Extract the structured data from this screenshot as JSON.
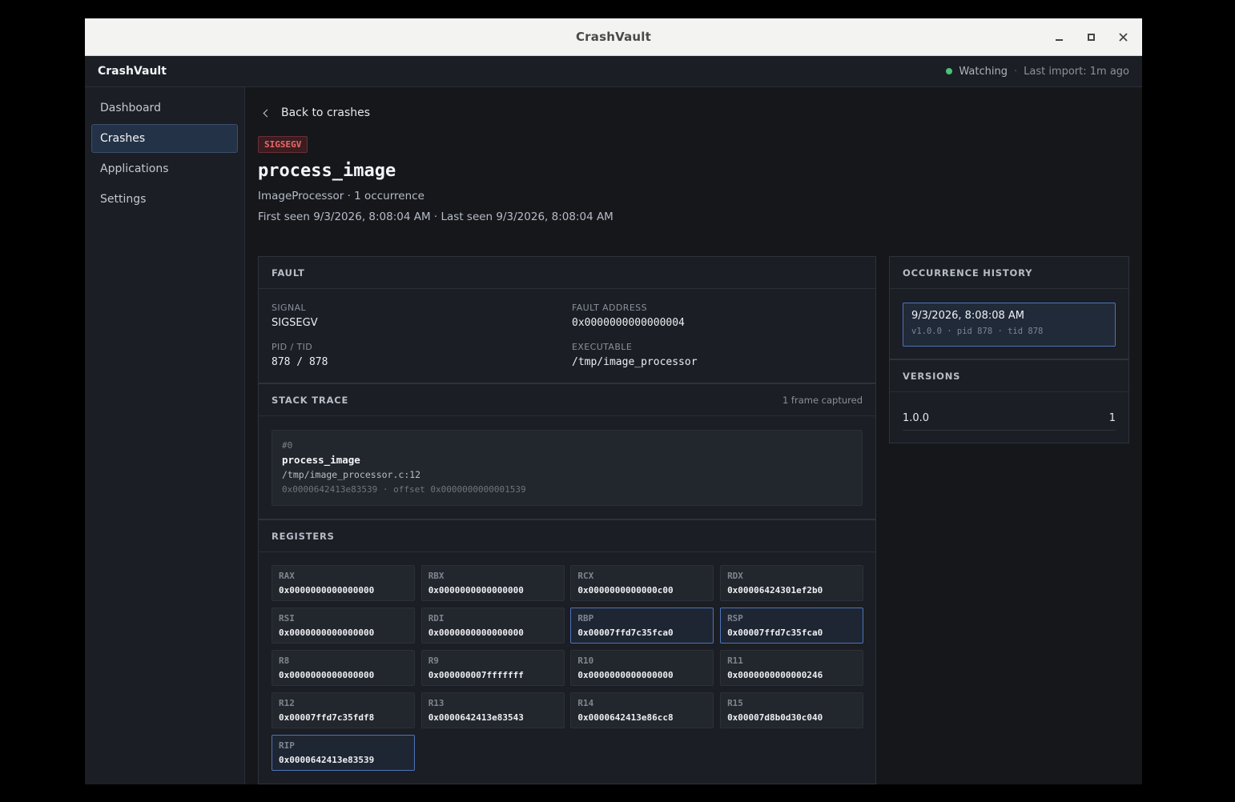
{
  "window": {
    "title": "CrashVault"
  },
  "appbar": {
    "brand": "CrashVault",
    "status": "Watching",
    "separator": "·",
    "last_import": "Last import: 1m ago",
    "status_color": "#4ac27a"
  },
  "sidebar": {
    "items": [
      {
        "label": "Dashboard",
        "active": false
      },
      {
        "label": "Crashes",
        "active": true
      },
      {
        "label": "Applications",
        "active": false
      },
      {
        "label": "Settings",
        "active": false
      }
    ]
  },
  "detail": {
    "back_label": "Back to crashes",
    "signal_badge": "SIGSEGV",
    "title": "process_image",
    "meta_line1": "ImageProcessor · 1 occurrence",
    "meta_line2": "First seen 9/3/2026, 8:08:04 AM · Last seen 9/3/2026, 8:08:04 AM"
  },
  "fault": {
    "heading": "FAULT",
    "signal_label": "SIGNAL",
    "signal_value": "SIGSEGV",
    "fault_address_label": "FAULT ADDRESS",
    "fault_address_value": "0x0000000000000004",
    "pid_tid_label": "PID / TID",
    "pid_tid_value": "878 / 878",
    "executable_label": "EXECUTABLE",
    "executable_value": "/tmp/image_processor"
  },
  "stack": {
    "heading": "STACK TRACE",
    "frames_captured": "1 frame captured",
    "frames": [
      {
        "index": "#0",
        "function": "process_image",
        "source": "/tmp/image_processor.c:12",
        "address": "0x0000642413e83539 · offset 0x0000000000001539"
      }
    ]
  },
  "registers": {
    "heading": "REGISTERS",
    "items": [
      {
        "name": "RAX",
        "value": "0x0000000000000000",
        "highlight": false
      },
      {
        "name": "RBX",
        "value": "0x0000000000000000",
        "highlight": false
      },
      {
        "name": "RCX",
        "value": "0x0000000000000c00",
        "highlight": false
      },
      {
        "name": "RDX",
        "value": "0x00006424301ef2b0",
        "highlight": false
      },
      {
        "name": "RSI",
        "value": "0x0000000000000000",
        "highlight": false
      },
      {
        "name": "RDI",
        "value": "0x0000000000000000",
        "highlight": false
      },
      {
        "name": "RBP",
        "value": "0x00007ffd7c35fca0",
        "highlight": true
      },
      {
        "name": "RSP",
        "value": "0x00007ffd7c35fca0",
        "highlight": true
      },
      {
        "name": "R8",
        "value": "0x0000000000000000",
        "highlight": false
      },
      {
        "name": "R9",
        "value": "0x000000007fffffff",
        "highlight": false
      },
      {
        "name": "R10",
        "value": "0x0000000000000000",
        "highlight": false
      },
      {
        "name": "R11",
        "value": "0x0000000000000246",
        "highlight": false
      },
      {
        "name": "R12",
        "value": "0x00007ffd7c35fdf8",
        "highlight": false
      },
      {
        "name": "R13",
        "value": "0x0000642413e83543",
        "highlight": false
      },
      {
        "name": "R14",
        "value": "0x0000642413e86cc8",
        "highlight": false
      },
      {
        "name": "R15",
        "value": "0x00007d8b0d30c040",
        "highlight": false
      },
      {
        "name": "RIP",
        "value": "0x0000642413e83539",
        "highlight": true
      }
    ]
  },
  "history": {
    "heading": "OCCURRENCE HISTORY",
    "items": [
      {
        "when": "9/3/2026, 8:08:08 AM",
        "details": "v1.0.0 · pid 878 · tid 878"
      }
    ]
  },
  "versions": {
    "heading": "VERSIONS",
    "items": [
      {
        "version": "1.0.0",
        "count": "1"
      }
    ]
  }
}
